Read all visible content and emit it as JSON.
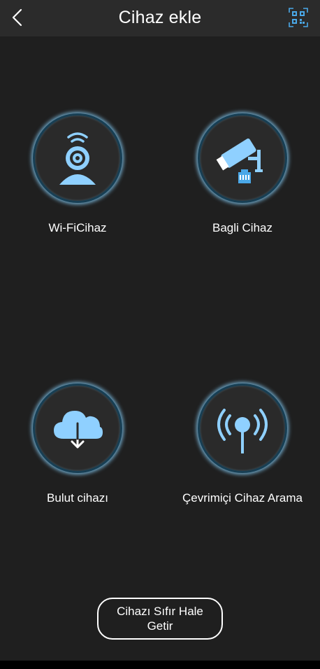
{
  "header": {
    "title": "Cihaz ekle",
    "back_icon": "chevron-left-icon",
    "qr_icon": "qr-scan-icon"
  },
  "tiles": [
    {
      "label": "Wi-FiCihaz",
      "icon": "wifi-camera-icon"
    },
    {
      "label": "Bagli Cihaz",
      "icon": "wired-camera-icon"
    },
    {
      "label": "Bulut cihazı",
      "icon": "cloud-download-icon"
    },
    {
      "label": "Çevrimiçi Cihaz Arama",
      "icon": "broadcast-icon"
    }
  ],
  "reset_button": {
    "label": "Cihazı Sıfır Hale Getir"
  },
  "colors": {
    "accent": "#4aa8e8",
    "icon_light": "#8fd0ff",
    "background": "#1f1f1f",
    "header": "#2b2b2b"
  }
}
